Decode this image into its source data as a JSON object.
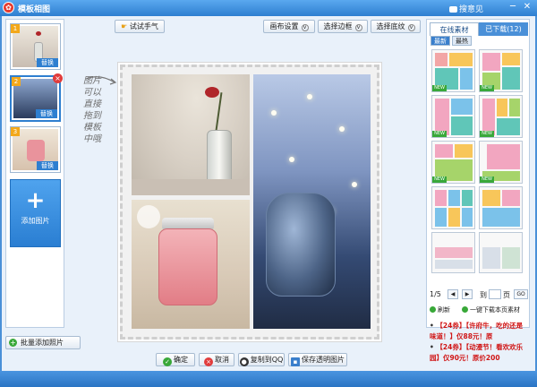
{
  "window": {
    "title": "模板相图",
    "feedback": "搜意见",
    "minimize": "─",
    "close": "✕"
  },
  "left_panel": {
    "thumbs": [
      {
        "number": "1",
        "replace": "替换"
      },
      {
        "number": "2",
        "replace": "替换"
      },
      {
        "number": "3",
        "replace": "替换"
      }
    ],
    "add_photo": "添加图片",
    "batch_add": "批量添加照片"
  },
  "toolbar": {
    "try_luck": "试试手气",
    "canvas_settings": "画布设置",
    "select_border": "选择边框",
    "select_background": "选择底纹"
  },
  "hint": "图片可以直接拖到模板中哦",
  "right_panel": {
    "tab_online": "在线素材",
    "tab_downloaded": "已下载(12)",
    "sub_latest": "最新",
    "sub_hot": "最热",
    "new_tag": "NEW",
    "page_indicator": "1/5",
    "goto_label": "到",
    "page_label": "页",
    "go": "GO",
    "refresh": "刷新",
    "download_all": "一键下载本页素材",
    "ads": [
      "【24券】【许府牛，吃的还是味道！】仅88元！原",
      "【24券】【动漫节！看欢欢乐园】仅90元！原价200"
    ]
  },
  "bottom_buttons": {
    "confirm": "确定",
    "cancel": "取消",
    "copy_qq": "复制到QQ",
    "save_transparent": "保存透明图片"
  },
  "colors": {
    "accent": "#2e7fd0",
    "ad_red": "#d01414",
    "new_green": "#39a83a"
  }
}
